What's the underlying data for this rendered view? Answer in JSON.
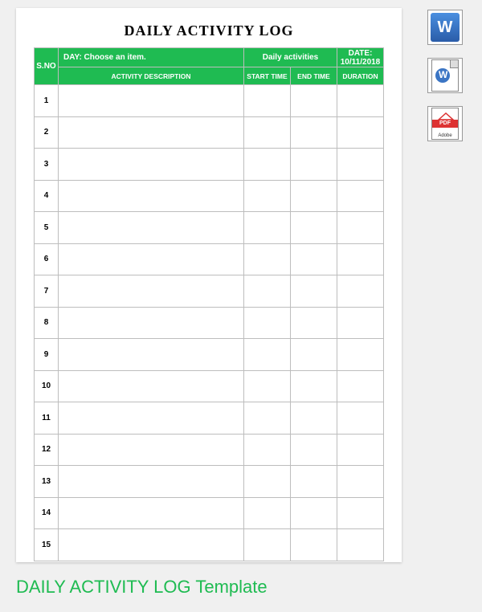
{
  "title": "DAILY ACTIVITY LOG",
  "header": {
    "sno": "S.NO",
    "day": "DAY:  Choose an item.",
    "middle": "Daily activities",
    "date": "DATE: 10/11/2018"
  },
  "columns": {
    "desc": "ACTIVITY DESCRIPTION",
    "start": "START TIME",
    "end": "END TIME",
    "dur": "DURATION"
  },
  "rows": [
    {
      "no": "1"
    },
    {
      "no": "2"
    },
    {
      "no": "3"
    },
    {
      "no": "4"
    },
    {
      "no": "5"
    },
    {
      "no": "6"
    },
    {
      "no": "7"
    },
    {
      "no": "8"
    },
    {
      "no": "9"
    },
    {
      "no": "10"
    },
    {
      "no": "11"
    },
    {
      "no": "12"
    },
    {
      "no": "13"
    },
    {
      "no": "14"
    },
    {
      "no": "15"
    }
  ],
  "icons": {
    "word": "W",
    "word2": "W",
    "pdf_band": "PDF",
    "pdf_brand": "Adobe"
  },
  "caption_strong": "DAILY ACTIVITY LOG",
  "caption_light": " Template"
}
